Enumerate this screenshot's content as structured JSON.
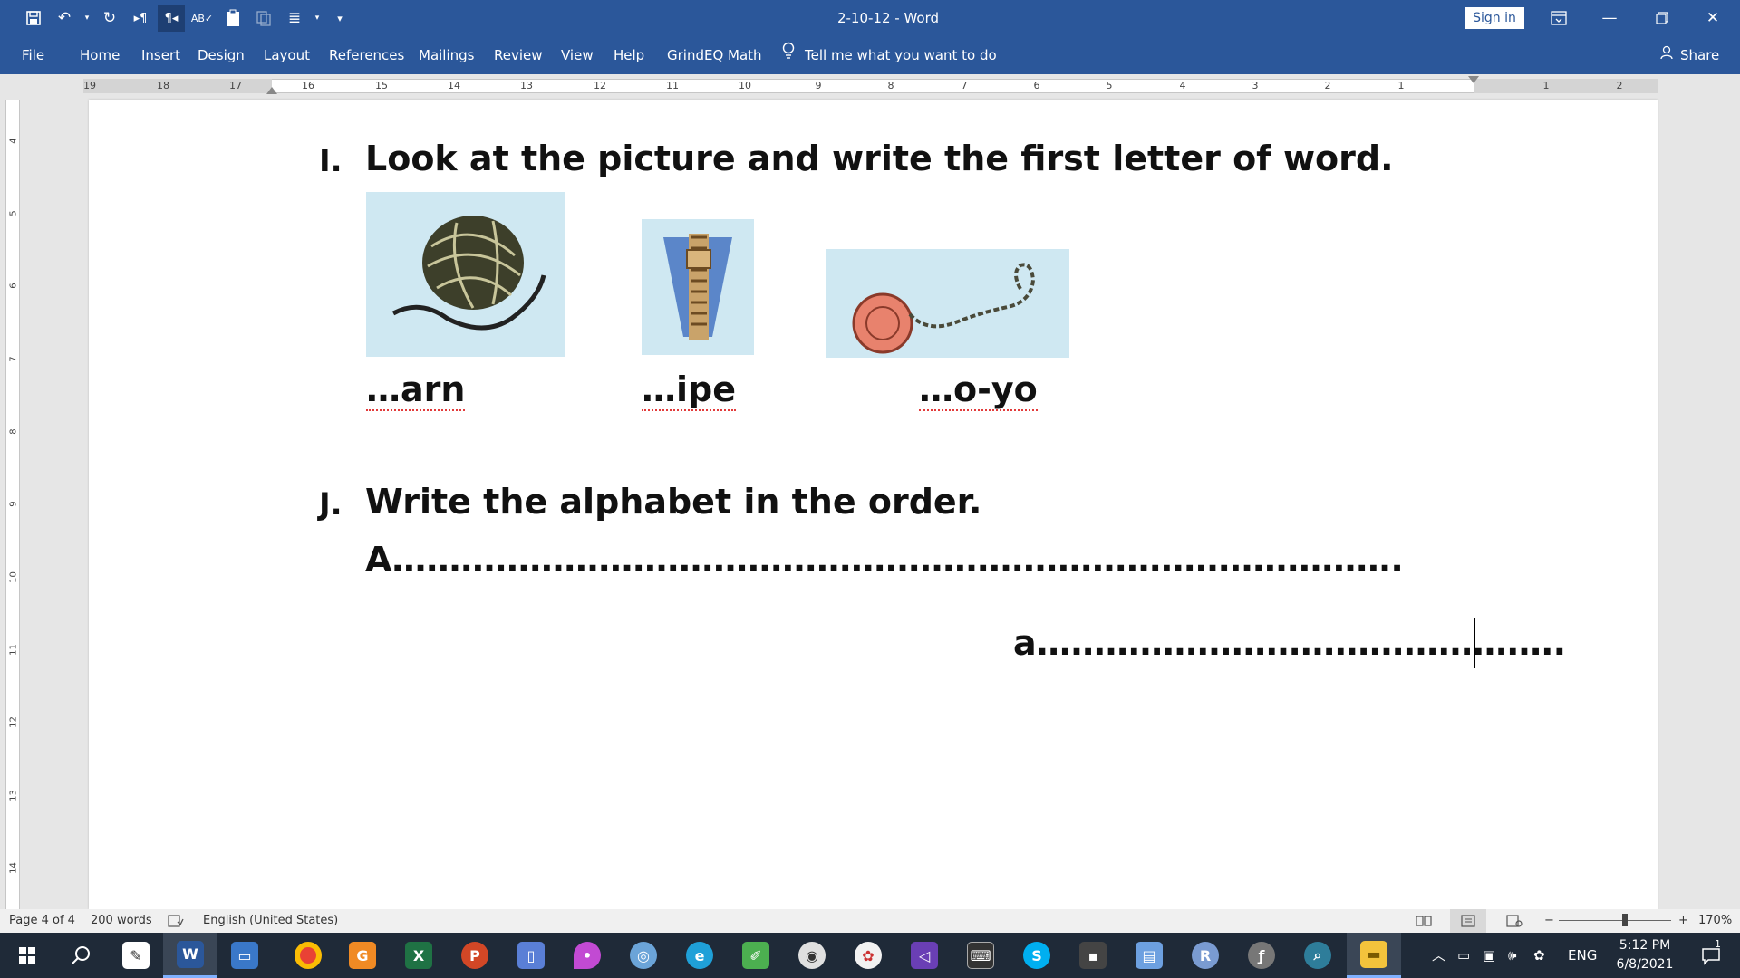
{
  "window": {
    "title": "2-10-12  -  Word",
    "sign_in": "Sign in"
  },
  "qat": {
    "icons": [
      "save-icon",
      "undo-icon",
      "redo-icon",
      "paragraph-ltr-icon",
      "paragraph-rtl-icon",
      "spelling-icon",
      "paste-icon",
      "copy-icon",
      "list-icon",
      "customize-icon"
    ]
  },
  "ribbon": {
    "tabs": [
      "File",
      "Home",
      "Insert",
      "Design",
      "Layout",
      "References",
      "Mailings",
      "Review",
      "View",
      "Help",
      "GrindEQ Math"
    ],
    "tell_me": "Tell me what you want to do",
    "share": "Share"
  },
  "ruler": {
    "horizontal": [
      "19",
      "18",
      "17",
      "16",
      "15",
      "14",
      "13",
      "12",
      "11",
      "10",
      "9",
      "8",
      "7",
      "6",
      "5",
      "4",
      "3",
      "2",
      "1",
      "1",
      "2"
    ],
    "vertical": [
      "4",
      "5",
      "6",
      "7",
      "8",
      "9",
      "10",
      "11",
      "12",
      "13",
      "14"
    ]
  },
  "document": {
    "q1": {
      "letter": "I.",
      "text": "Look at the picture and write the first letter of word."
    },
    "words": [
      "…arn",
      "…ipe",
      "…o-yo"
    ],
    "q2": {
      "letter": "J.",
      "text": "Write the alphabet in the order."
    },
    "line_upper": "A…………………………………………………………………………….",
    "line_lower": "a………………………………………."
  },
  "status": {
    "page": "Page 4 of 4",
    "words": "200 words",
    "language": "English (United States)",
    "zoom": "170%"
  },
  "taskbar": {
    "apps": [
      "start-icon",
      "search-icon",
      "pen-icon",
      "word-icon",
      "computer-icon",
      "chrome-icon",
      "pdf-icon",
      "excel-icon",
      "powerpoint-icon",
      "notebook-icon",
      "drop-icon",
      "globe-icon",
      "edge-icon",
      "pencil-icon",
      "disc-icon",
      "paint-icon",
      "visual-studio-icon",
      "keyboard-icon",
      "skype-icon",
      "folder-icon",
      "files-icon",
      "r-icon",
      "flash-icon",
      "search-globe-icon",
      "file-explorer-icon"
    ],
    "language": "ENG",
    "time": "5:12 PM",
    "date": "6/8/2021",
    "notification_count": "1"
  }
}
